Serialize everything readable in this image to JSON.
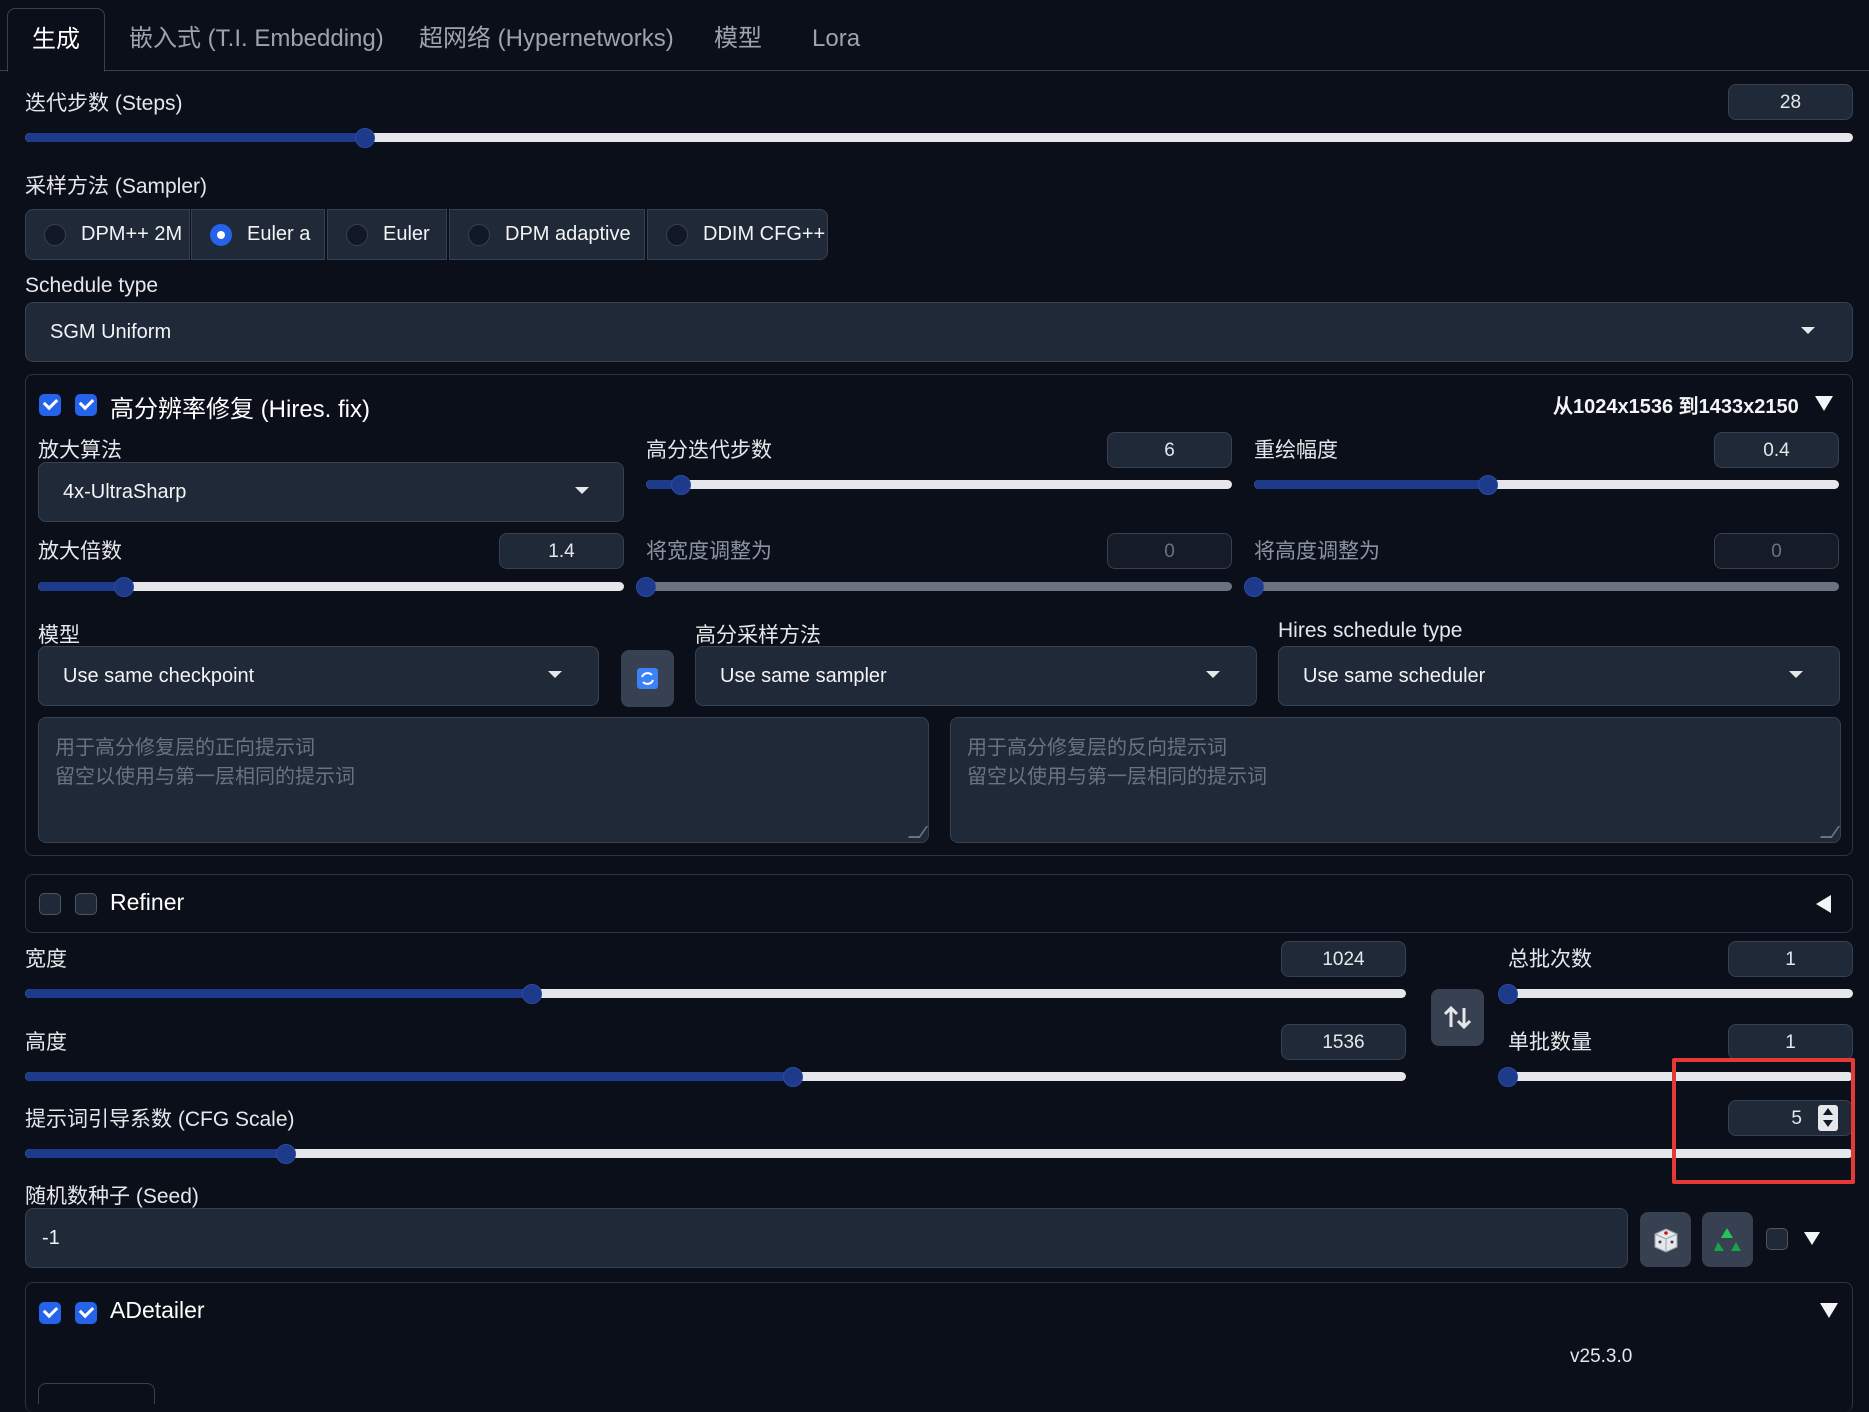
{
  "tabs": [
    "生成",
    "嵌入式 (T.I. Embedding)",
    "超网络 (Hypernetworks)",
    "模型",
    "Lora"
  ],
  "steps": {
    "label": "迭代步数 (Steps)",
    "value": "28",
    "fraction": 0.186
  },
  "sampler": {
    "label": "采样方法 (Sampler)",
    "options": [
      "DPM++ 2M",
      "Euler a",
      "Euler",
      "DPM adaptive",
      "DDIM CFG++"
    ],
    "selected": "Euler a"
  },
  "schedule": {
    "label": "Schedule type",
    "value": "SGM Uniform"
  },
  "hires": {
    "title": "高分辨率修复 (Hires. fix)",
    "resolution_info": "从1024x1536 到1433x2150",
    "upscaler": {
      "label": "放大算法",
      "value": "4x-UltraSharp"
    },
    "hires_steps": {
      "label": "高分迭代步数",
      "value": "6",
      "fraction": 0.06
    },
    "denoise": {
      "label": "重绘幅度",
      "value": "0.4",
      "fraction": 0.4
    },
    "scale": {
      "label": "放大倍数",
      "value": "1.4",
      "fraction": 0.146
    },
    "resize_width": {
      "label": "将宽度调整为",
      "value": "0"
    },
    "resize_height": {
      "label": "将高度调整为",
      "value": "0"
    },
    "checkpoint": {
      "label": "模型",
      "value": "Use same checkpoint"
    },
    "hires_sampler": {
      "label": "高分采样方法",
      "value": "Use same sampler"
    },
    "hires_schedule": {
      "label": "Hires schedule type",
      "value": "Use same scheduler"
    },
    "prompt_placeholder": "用于高分修复层的正向提示词\n留空以使用与第一层相同的提示词",
    "neg_prompt_placeholder": "用于高分修复层的反向提示词\n留空以使用与第一层相同的提示词"
  },
  "refiner": {
    "title": "Refiner"
  },
  "width": {
    "label": "宽度",
    "value": "1024",
    "fraction": 0.367
  },
  "height": {
    "label": "高度",
    "value": "1536",
    "fraction": 0.556
  },
  "batch_count": {
    "label": "总批次数",
    "value": "1",
    "fraction": 0
  },
  "batch_size": {
    "label": "单批数量",
    "value": "1",
    "fraction": 0
  },
  "cfg": {
    "label": "提示词引导系数 (CFG Scale)",
    "value": "5",
    "fraction": 0.143
  },
  "seed": {
    "label": "随机数种子 (Seed)",
    "value": "-1"
  },
  "adetailer": {
    "title": "ADetailer",
    "version": "v25.3.0"
  },
  "colors": {
    "background": "#0b0f19",
    "accent": "#2563eb",
    "slider_fill": "#1e3a8a",
    "highlight": "#e53935"
  }
}
